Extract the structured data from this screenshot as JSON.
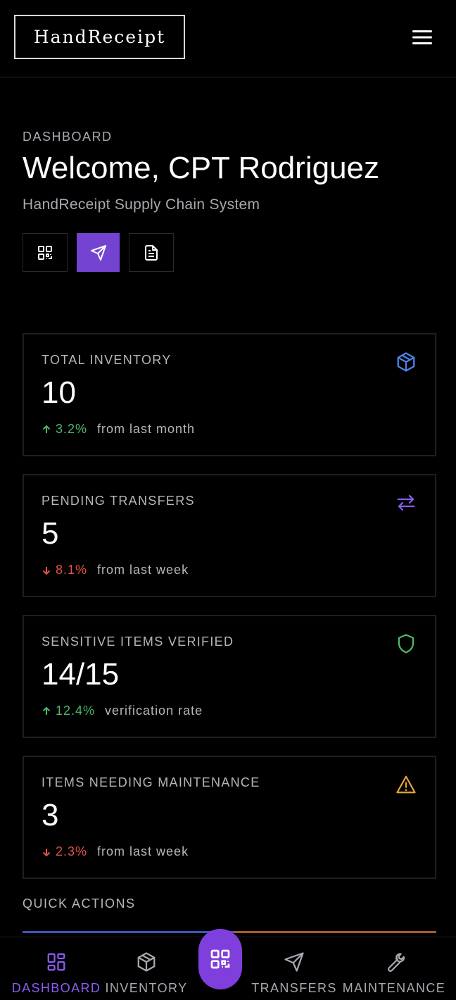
{
  "app": {
    "logo_text": "HandReceipt"
  },
  "header": {
    "menu_icon": "hamburger-menu-icon"
  },
  "page": {
    "eyebrow": "DASHBOARD",
    "title": "Welcome, CPT Rodriguez",
    "subtitle": "HandReceipt Supply Chain System"
  },
  "quick_buttons": [
    {
      "icon": "qr-code-icon",
      "active": false
    },
    {
      "icon": "send-icon",
      "active": true
    },
    {
      "icon": "document-icon",
      "active": false
    }
  ],
  "stats": [
    {
      "label": "TOTAL INVENTORY",
      "value": "10",
      "change": "3.2%",
      "direction": "up",
      "note": "from last month",
      "icon": "package-icon",
      "icon_color": "#4f82e8"
    },
    {
      "label": "PENDING TRANSFERS",
      "value": "5",
      "change": "8.1%",
      "direction": "down",
      "note": "from last week",
      "icon": "transfer-arrows-icon",
      "icon_color": "#8b5cf6"
    },
    {
      "label": "SENSITIVE ITEMS VERIFIED",
      "value": "14/15",
      "change": "12.4%",
      "direction": "up",
      "note": "verification rate",
      "icon": "shield-icon",
      "icon_color": "#4bb96a"
    },
    {
      "label": "ITEMS NEEDING MAINTENANCE",
      "value": "3",
      "change": "2.3%",
      "direction": "down",
      "note": "from last week",
      "icon": "warning-icon",
      "icon_color": "#e6a23c"
    }
  ],
  "quick_actions": {
    "title": "QUICK ACTIONS"
  },
  "bottom_nav": {
    "items": [
      {
        "label": "DASHBOARD",
        "icon": "dashboard-icon",
        "active": true
      },
      {
        "label": "INVENTORY",
        "icon": "package-icon",
        "active": false
      },
      {
        "label": "TRANSFERS",
        "icon": "send-icon",
        "active": false
      },
      {
        "label": "MAINTENANCE",
        "icon": "wrench-icon",
        "active": false
      }
    ],
    "center_button_icon": "qr-code-icon"
  },
  "colors": {
    "accent": "#7443d1",
    "positive": "#4bb96a",
    "negative": "#e0524c",
    "background": "#000000"
  }
}
